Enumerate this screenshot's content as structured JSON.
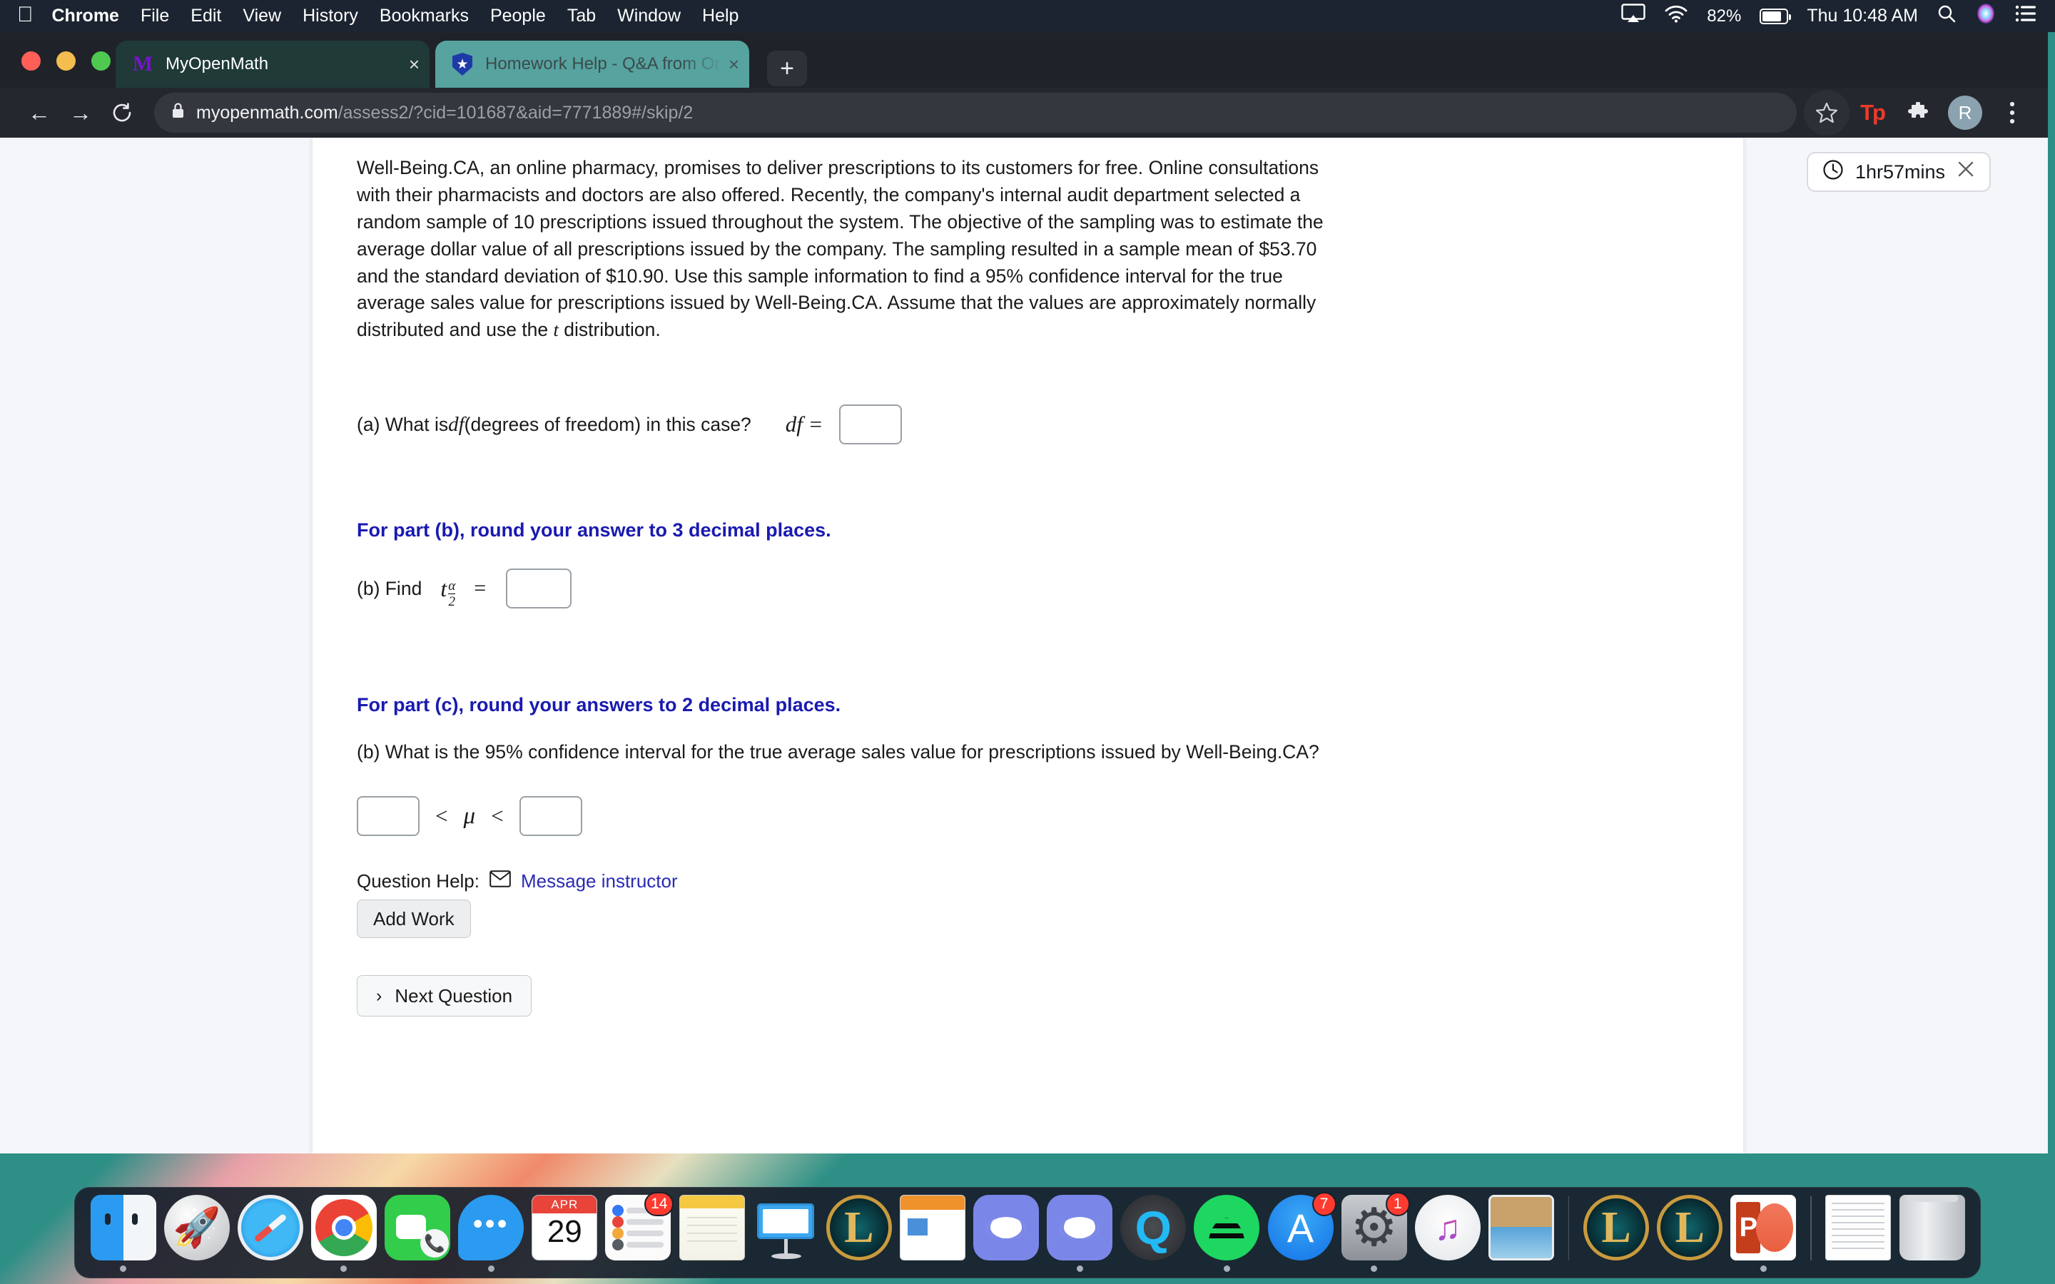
{
  "menubar": {
    "apple_icon": "apple-logo-icon",
    "items": [
      "Chrome",
      "File",
      "Edit",
      "View",
      "History",
      "Bookmarks",
      "People",
      "Tab",
      "Window",
      "Help"
    ],
    "active_app": "Chrome",
    "status": {
      "screen_mirroring_icon": "airplay-icon",
      "wifi_icon": "wifi-icon",
      "battery_percent": "82%",
      "battery_icon": "battery-icon",
      "clock": "Thu 10:48 AM",
      "search_icon": "spotlight-search-icon",
      "siri_icon": "siri-icon",
      "control_center_icon": "control-center-icon"
    }
  },
  "browser": {
    "traffic_lights": {
      "close": "#ff5f57",
      "minimize": "#f5bd4f",
      "zoom": "#4fc94f"
    },
    "tabs": [
      {
        "title": "MyOpenMath",
        "favicon": "myopenmath-favicon",
        "active": true,
        "close_label": "×"
      },
      {
        "title": "Homework Help - Q&A from Or",
        "favicon": "course-hero-favicon",
        "active": false,
        "close_label": "×"
      }
    ],
    "new_tab_label": "+",
    "toolbar": {
      "back_icon": "back-arrow-icon",
      "forward_icon": "forward-arrow-icon",
      "reload_icon": "reload-icon",
      "lock_icon": "lock-icon",
      "url_host": "myopenmath.com",
      "url_rest": "/assess2/?cid=101687&aid=7771889#/skip/2",
      "bookmark_icon": "star-bookmark-icon",
      "extension_tp_label": "Tp",
      "extensions_icon": "puzzle-piece-icon",
      "profile_initial": "R",
      "menu_icon": "three-dot-menu-icon"
    }
  },
  "timer": {
    "clock_icon": "clock-icon",
    "remaining": "1hr57mins",
    "close_label": "×"
  },
  "question": {
    "body": "Well-Being.CA, an online pharmacy, promises to deliver prescriptions to its customers for free. Online consultations with their pharmacists and doctors are also offered. Recently, the company's internal audit department selected a random sample of 10 prescriptions issued throughout the system. The objective of the sampling was to estimate the average dollar value of all prescriptions issued by the company. The sampling resulted in a sample mean of $53.70 and the standard deviation of $10.90. Use this sample information to find a 95% confidence interval for the true average sales value for prescriptions issued by Well-Being.CA. Assume that the values are approximately normally distributed and use the ",
    "body_math_tail": "t",
    "body_end": " distribution.",
    "part_a": {
      "prefix": "(a) What is ",
      "math": "df",
      "suffix": " (degrees of freedom) in this case?",
      "eq_label": "df =",
      "answer_value": "",
      "placeholder": ""
    },
    "note_b": "For part (b), round your answer to 3 decimal places.",
    "part_b": {
      "label": "(b) Find",
      "math_base": "t",
      "math_sub_num": "α",
      "math_sub_den": "2",
      "eq": "=",
      "answer_value": "",
      "placeholder": ""
    },
    "note_c": "For part (c), round your answers to 2 decimal places.",
    "part_c": {
      "text": "(b) What is the 95% confidence interval for the true average sales value for prescriptions issued by Well-Being.CA?",
      "lower_value": "",
      "upper_value": "",
      "rel_left": "<",
      "mu": "μ",
      "rel_right": "<"
    },
    "help_label": "Question Help:",
    "message_instructor": "Message instructor",
    "envelope_icon": "envelope-icon",
    "add_work_label": "Add Work",
    "next_question_label": "Next Question",
    "next_chevron": "›"
  },
  "dock": {
    "items": [
      {
        "name": "finder",
        "label": "Finder",
        "icon": "finder-icon",
        "running": true
      },
      {
        "name": "launchpad",
        "label": "Launchpad",
        "icon": "launchpad-icon",
        "running": false
      },
      {
        "name": "safari",
        "label": "Safari",
        "icon": "safari-icon",
        "running": false
      },
      {
        "name": "chrome",
        "label": "Google Chrome",
        "icon": "chrome-icon",
        "running": true
      },
      {
        "name": "facetime",
        "label": "FaceTime",
        "icon": "facetime-icon",
        "running": false
      },
      {
        "name": "messages",
        "label": "Messages",
        "icon": "messages-icon",
        "running": true
      },
      {
        "name": "calendar",
        "label": "Calendar",
        "icon": "calendar-icon",
        "running": false,
        "cal_month": "APR",
        "cal_day": "29"
      },
      {
        "name": "reminders",
        "label": "Reminders",
        "icon": "reminders-icon",
        "running": false,
        "badge": "14"
      },
      {
        "name": "notes",
        "label": "Notes",
        "icon": "notes-icon",
        "running": false
      },
      {
        "name": "keynote",
        "label": "Keynote",
        "icon": "keynote-icon",
        "running": false
      },
      {
        "name": "league-of-legends",
        "label": "League of Legends",
        "icon": "league-of-legends-icon",
        "running": false
      },
      {
        "name": "pages",
        "label": "Pages",
        "icon": "pages-icon",
        "running": false
      },
      {
        "name": "discord",
        "label": "Discord",
        "icon": "discord-icon",
        "running": false
      },
      {
        "name": "discord-2",
        "label": "Discord",
        "icon": "discord-icon",
        "running": true
      },
      {
        "name": "quicktime",
        "label": "QuickTime Player",
        "icon": "quicktime-icon",
        "running": false
      },
      {
        "name": "spotify",
        "label": "Spotify",
        "icon": "spotify-icon",
        "running": true
      },
      {
        "name": "app-store",
        "label": "App Store",
        "icon": "app-store-icon",
        "running": false,
        "badge": "7"
      },
      {
        "name": "system-preferences",
        "label": "System Preferences",
        "icon": "system-preferences-icon",
        "running": true,
        "badge": "1"
      },
      {
        "name": "itunes",
        "label": "Music",
        "icon": "itunes-icon",
        "running": false
      },
      {
        "name": "photos",
        "label": "Photos",
        "icon": "photos-icon",
        "running": false
      }
    ],
    "stack_items": [
      {
        "name": "league-of-legends-file",
        "label": "League of Legends",
        "icon": "league-of-legends-icon",
        "running": false
      },
      {
        "name": "league-of-legends-file-2",
        "label": "League of Legends",
        "icon": "league-of-legends-icon",
        "running": false
      },
      {
        "name": "powerpoint",
        "label": "Microsoft PowerPoint",
        "icon": "powerpoint-icon",
        "running": true
      }
    ],
    "trash_items": [
      {
        "name": "document",
        "label": "Document",
        "icon": "document-icon",
        "running": false
      },
      {
        "name": "trash",
        "label": "Trash",
        "icon": "trash-icon",
        "running": false
      }
    ]
  }
}
